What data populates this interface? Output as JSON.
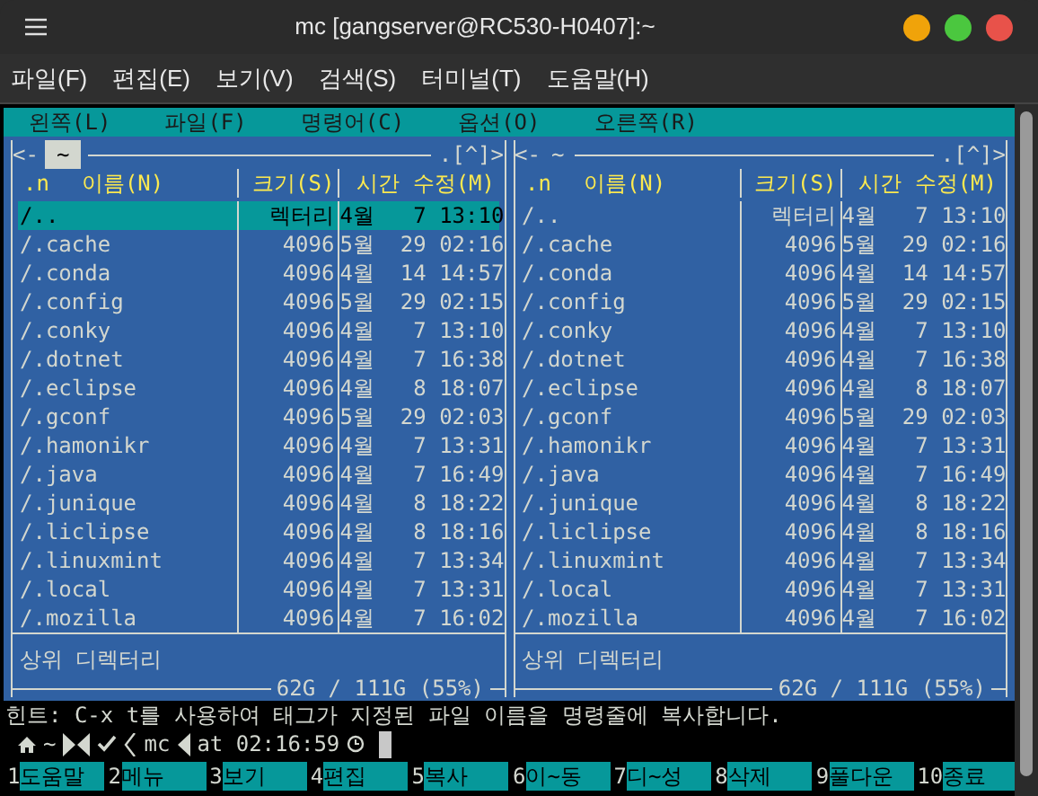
{
  "window": {
    "title": "mc [gangserver@RC530-H0407]:~"
  },
  "menu": [
    "파일(F)",
    "편집(E)",
    "보기(V)",
    "검색(S)",
    "터미널(T)",
    "도움말(H)"
  ],
  "mc_menu": [
    "왼쪽(L)",
    "파일(F)",
    "명령어(C)",
    "옵션(O)",
    "오른쪽(R)"
  ],
  "panels": [
    {
      "back": "<-",
      "path": "~",
      "active": true,
      "controls": ".[^]>",
      "sort_mark": ".n",
      "columns": [
        "이름(N)",
        "크기(S)",
        "시간 수정(M)"
      ],
      "rows": [
        {
          "name": "/..",
          "size": "렉터리",
          "modified": "4월   7 13:10",
          "selected": true
        },
        {
          "name": "/.cache",
          "size": "4096",
          "modified": "5월  29 02:16",
          "selected": false
        },
        {
          "name": "/.conda",
          "size": "4096",
          "modified": "4월  14 14:57",
          "selected": false
        },
        {
          "name": "/.config",
          "size": "4096",
          "modified": "5월  29 02:15",
          "selected": false
        },
        {
          "name": "/.conky",
          "size": "4096",
          "modified": "4월   7 13:10",
          "selected": false
        },
        {
          "name": "/.dotnet",
          "size": "4096",
          "modified": "4월   7 16:38",
          "selected": false
        },
        {
          "name": "/.eclipse",
          "size": "4096",
          "modified": "4월   8 18:07",
          "selected": false
        },
        {
          "name": "/.gconf",
          "size": "4096",
          "modified": "5월  29 02:03",
          "selected": false
        },
        {
          "name": "/.hamonikr",
          "size": "4096",
          "modified": "4월   7 13:31",
          "selected": false
        },
        {
          "name": "/.java",
          "size": "4096",
          "modified": "4월   7 16:49",
          "selected": false
        },
        {
          "name": "/.junique",
          "size": "4096",
          "modified": "4월   8 18:22",
          "selected": false
        },
        {
          "name": "/.liclipse",
          "size": "4096",
          "modified": "4월   8 18:16",
          "selected": false
        },
        {
          "name": "/.linuxmint",
          "size": "4096",
          "modified": "4월   7 13:34",
          "selected": false
        },
        {
          "name": "/.local",
          "size": "4096",
          "modified": "4월   7 13:31",
          "selected": false
        },
        {
          "name": "/.mozilla",
          "size": "4096",
          "modified": "4월   7 16:02",
          "selected": false
        }
      ],
      "info": "상위 디렉터리",
      "disk": "62G / 111G (55%)"
    },
    {
      "back": "<-",
      "path": "~",
      "active": false,
      "controls": ".[^]>",
      "sort_mark": ".n",
      "columns": [
        "이름(N)",
        "크기(S)",
        "시간 수정(M)"
      ],
      "rows": [
        {
          "name": "/..",
          "size": "렉터리",
          "modified": "4월   7 13:10",
          "selected": false
        },
        {
          "name": "/.cache",
          "size": "4096",
          "modified": "5월  29 02:16",
          "selected": false
        },
        {
          "name": "/.conda",
          "size": "4096",
          "modified": "4월  14 14:57",
          "selected": false
        },
        {
          "name": "/.config",
          "size": "4096",
          "modified": "5월  29 02:15",
          "selected": false
        },
        {
          "name": "/.conky",
          "size": "4096",
          "modified": "4월   7 13:10",
          "selected": false
        },
        {
          "name": "/.dotnet",
          "size": "4096",
          "modified": "4월   7 16:38",
          "selected": false
        },
        {
          "name": "/.eclipse",
          "size": "4096",
          "modified": "4월   8 18:07",
          "selected": false
        },
        {
          "name": "/.gconf",
          "size": "4096",
          "modified": "5월  29 02:03",
          "selected": false
        },
        {
          "name": "/.hamonikr",
          "size": "4096",
          "modified": "4월   7 13:31",
          "selected": false
        },
        {
          "name": "/.java",
          "size": "4096",
          "modified": "4월   7 16:49",
          "selected": false
        },
        {
          "name": "/.junique",
          "size": "4096",
          "modified": "4월   8 18:22",
          "selected": false
        },
        {
          "name": "/.liclipse",
          "size": "4096",
          "modified": "4월   8 18:16",
          "selected": false
        },
        {
          "name": "/.linuxmint",
          "size": "4096",
          "modified": "4월   7 13:34",
          "selected": false
        },
        {
          "name": "/.local",
          "size": "4096",
          "modified": "4월   7 13:31",
          "selected": false
        },
        {
          "name": "/.mozilla",
          "size": "4096",
          "modified": "4월   7 16:02",
          "selected": false
        }
      ],
      "info": "상위 디렉터리",
      "disk": "62G / 111G (55%)"
    }
  ],
  "hint": "힌트: C-x t를 사용하여 태그가 지정된 파일 이름을 명령줄에 복사합니다.",
  "prompt": {
    "dir": "~",
    "command": "mc",
    "time": "at 02:16:59"
  },
  "fkeys": [
    {
      "num": "1",
      "label": "도움말"
    },
    {
      "num": "2",
      "label": "메뉴"
    },
    {
      "num": "3",
      "label": "보기"
    },
    {
      "num": "4",
      "label": "편집"
    },
    {
      "num": "5",
      "label": "복사"
    },
    {
      "num": "6",
      "label": "이~동"
    },
    {
      "num": "7",
      "label": "디~성"
    },
    {
      "num": "8",
      "label": "삭제"
    },
    {
      "num": "9",
      "label": "풀다운"
    },
    {
      "num": "10",
      "label": "종료"
    }
  ]
}
